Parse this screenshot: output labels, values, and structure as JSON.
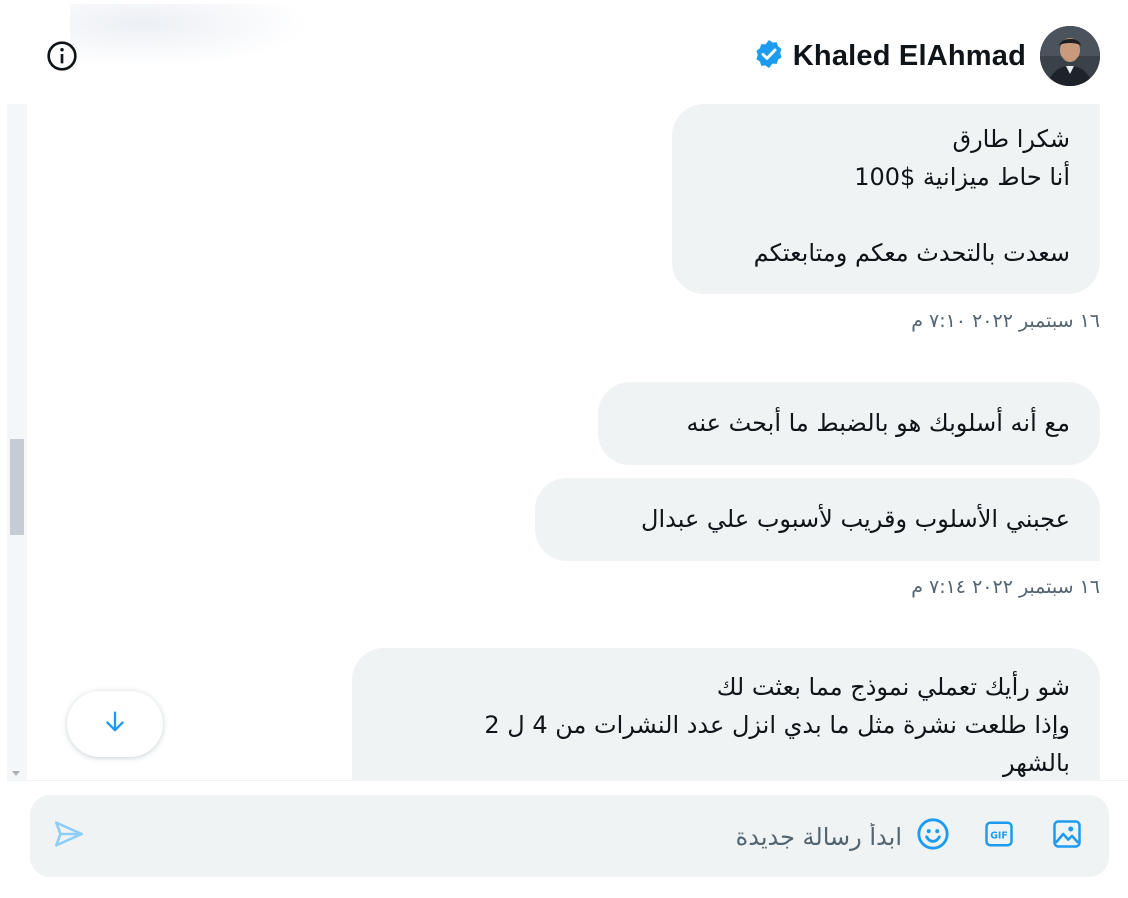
{
  "header": {
    "name": "Khaled ElAhmad",
    "verified_icon": "verified-badge-icon",
    "info_icon": "info-icon"
  },
  "messages": [
    {
      "lines": "شكرا طارق\nأنا حاط ميزانية $100\n\nسعدت بالتحدث معكم ومتابعتكم"
    },
    {
      "timestamp": "١٦ سبتمبر ٢٠٢٢ ٧:١٠ م"
    },
    {
      "lines": "مع أنه أسلوبك هو بالضبط ما أبحث عنه"
    },
    {
      "lines": "عجبني الأسلوب وقريب لأسبوب علي عبدال"
    },
    {
      "timestamp": "١٦ سبتمبر ٢٠٢٢ ٧:١٤ م"
    },
    {
      "lines": "شو رأيك تعملي نموذج مما بعثت لك\nوإذا طلعت نشرة مثل ما بدي انزل عدد النشرات من 4 ل 2\nبالشهر"
    }
  ],
  "composer": {
    "placeholder": "ابدأ رسالة جديدة",
    "value": "",
    "icons": [
      "send-icon",
      "emoji-icon",
      "gif-icon",
      "image-icon"
    ]
  },
  "scroll_down_icon": "arrow-down-icon",
  "colors": {
    "accent": "#1d9bf0",
    "bubble": "#eff3f4",
    "muted": "#536471"
  }
}
